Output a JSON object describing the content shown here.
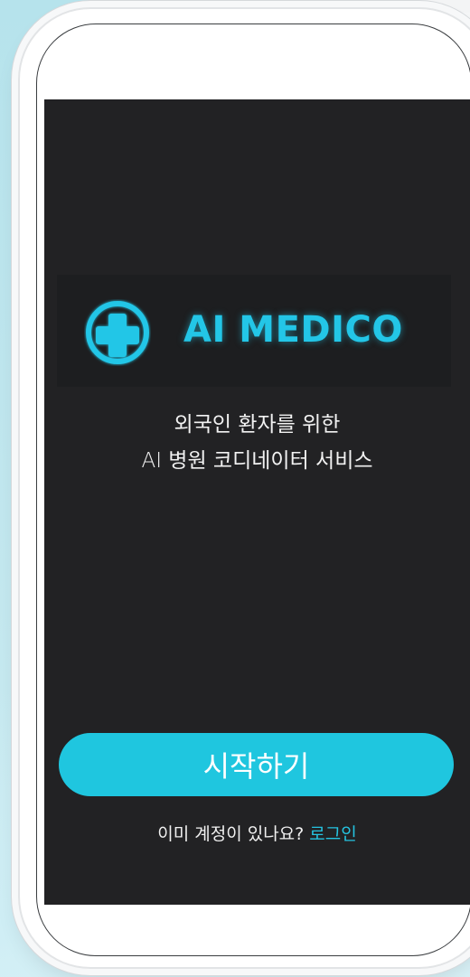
{
  "app": {
    "brand_name": "AI MEDICO",
    "logo_icon": "medical-cross-icon",
    "accent_color": "#1fc6df"
  },
  "welcome": {
    "tagline_line1": "외국인 환자를 위한",
    "tagline_line2": "AI 병원 코디네이터 서비스"
  },
  "actions": {
    "start_label": "시작하기",
    "login_prompt": "이미 계정이 있나요?",
    "login_link": "로그인"
  }
}
